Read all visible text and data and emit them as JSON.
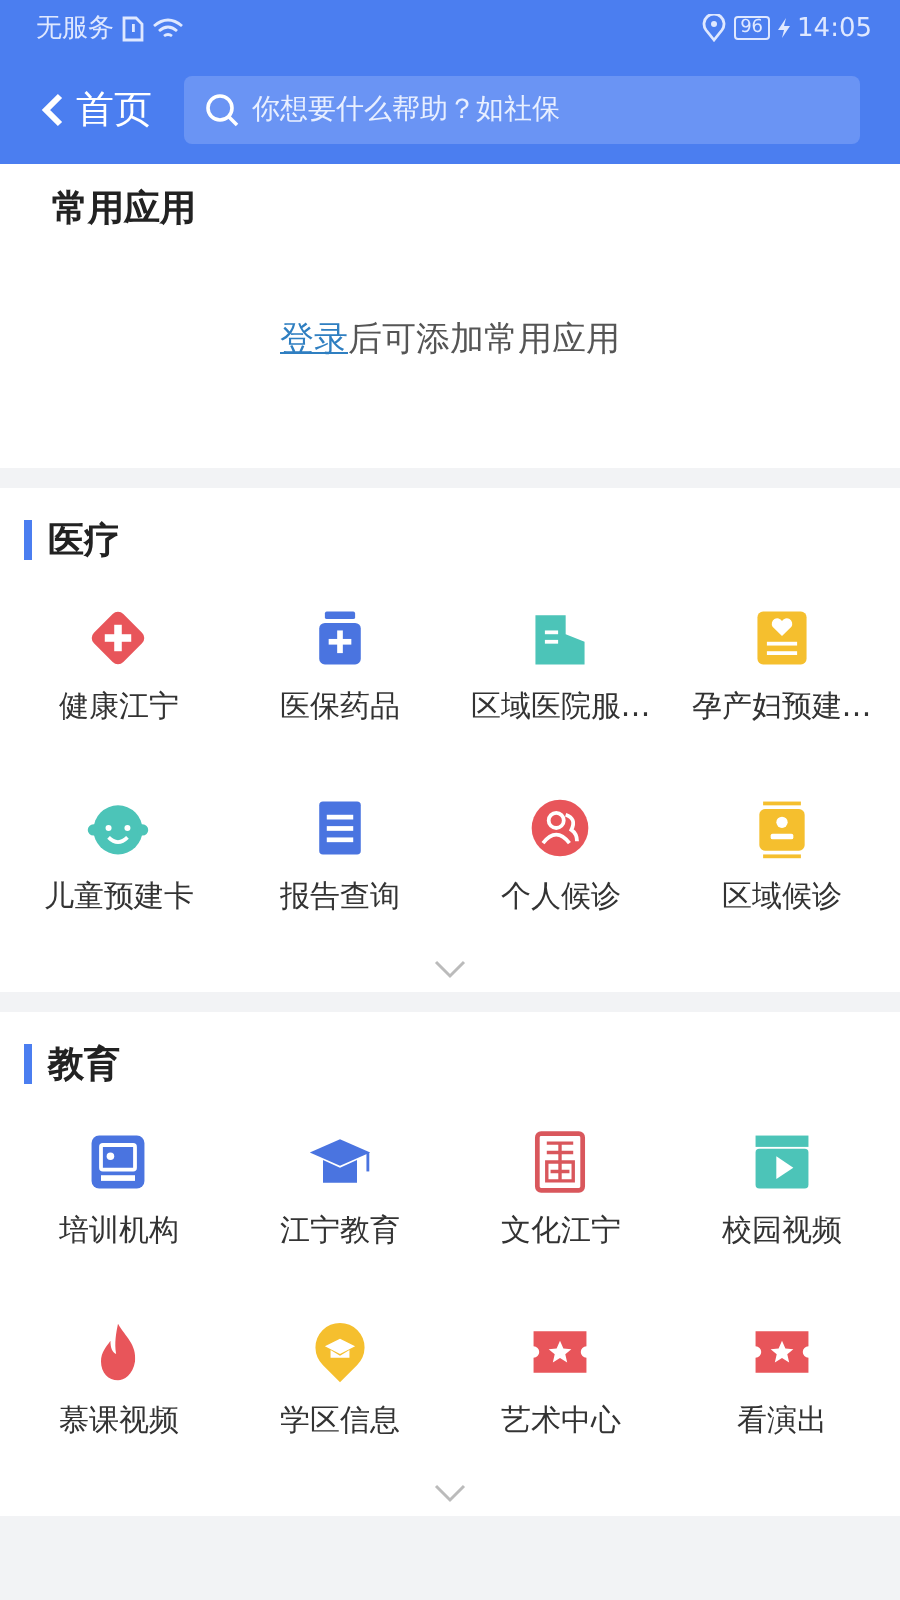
{
  "status_bar": {
    "carrier": "无服务",
    "battery": "96",
    "time": "14:05"
  },
  "nav": {
    "back_label": "首页",
    "search": {
      "placeholder": "你想要什么帮助？如社保"
    }
  },
  "common_apps": {
    "title": "常用应用",
    "login_link": "登录",
    "login_hint": "后可添加常用应用"
  },
  "sections": [
    {
      "title": "医疗",
      "expanded": false,
      "items": [
        {
          "label": "健康江宁",
          "kind": "cross",
          "color": "#e8555a"
        },
        {
          "label": "医保药品",
          "kind": "jar",
          "color": "#4a74e0"
        },
        {
          "label": "区域医院服…",
          "kind": "building",
          "color": "#4cc4b8"
        },
        {
          "label": "孕产妇预建…",
          "kind": "heart-card",
          "color": "#f5bf2e"
        },
        {
          "label": "儿童预建卡",
          "kind": "baby",
          "color": "#4cc4b8"
        },
        {
          "label": "报告查询",
          "kind": "clipboard",
          "color": "#4a74e0"
        },
        {
          "label": "个人候诊",
          "kind": "people",
          "color": "#e8555a"
        },
        {
          "label": "区域候诊",
          "kind": "id-card",
          "color": "#f5bf2e"
        }
      ]
    },
    {
      "title": "教育",
      "expanded": false,
      "items": [
        {
          "label": "培训机构",
          "kind": "classroom",
          "color": "#4a74e0"
        },
        {
          "label": "江宁教育",
          "kind": "cap",
          "color": "#4a74e0"
        },
        {
          "label": "文化江宁",
          "kind": "seal",
          "color": "#d9575c"
        },
        {
          "label": "校园视频",
          "kind": "video",
          "color": "#4cc4b8"
        },
        {
          "label": "慕课视频",
          "kind": "flame",
          "color": "#e8555a"
        },
        {
          "label": "学区信息",
          "kind": "pin",
          "color": "#f5bf2e"
        },
        {
          "label": "艺术中心",
          "kind": "ticket",
          "color": "#e8555a"
        },
        {
          "label": "看演出",
          "kind": "ticket",
          "color": "#e8555a"
        }
      ]
    }
  ]
}
